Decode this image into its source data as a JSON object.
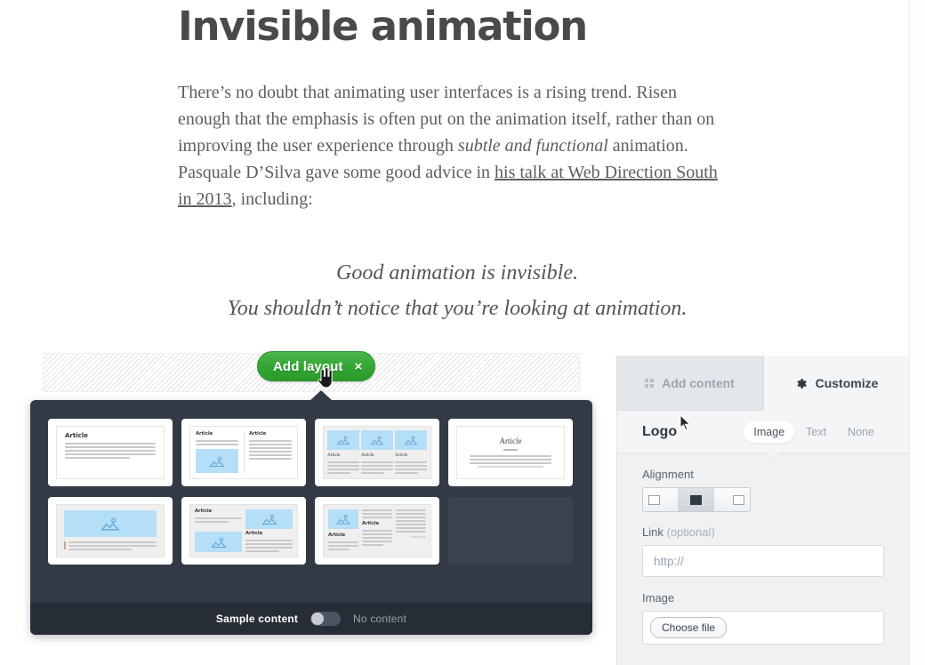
{
  "article": {
    "title": "Invisible animation",
    "paragraph_parts": {
      "p1": "There’s no doubt that animating user interfaces is a rising trend. Risen enough that the emphasis is often put on the animation itself, rather than on improving the user experience through ",
      "emphasis": "subtle and functional",
      "p2": " animation. Pasquale D’Silva gave some good advice in ",
      "link": "his talk at Web Direction South in 2013",
      "p3": ", including:"
    },
    "pullquote_line1": "Good animation is invisible.",
    "pullquote_line2": "You shouldn’t notice that you’re looking at animation."
  },
  "editor": {
    "add_layout_label": "Add layout",
    "close_label": "×",
    "accent_green": "#32a532",
    "panel_dark": "#323a45",
    "footer_dark": "#272d36",
    "toggle": {
      "on_label": "Sample content",
      "off_label": "No content",
      "state": "on"
    },
    "layouts": [
      {
        "id": "single-article",
        "title": "Article"
      },
      {
        "id": "two-column-image-left",
        "title_left": "Article",
        "title_right": "Article"
      },
      {
        "id": "three-column-cards",
        "title_a": "Article",
        "title_b": "Article",
        "title_c": "Article"
      },
      {
        "id": "centered-article",
        "title": "Article"
      },
      {
        "id": "hero-image",
        "title": ""
      },
      {
        "id": "mixed-grid",
        "title_a": "Article",
        "title_b": "Article"
      },
      {
        "id": "image-with-columns",
        "title_a": "Article",
        "title_b": "Article"
      },
      {
        "id": "empty-slot",
        "title": ""
      }
    ]
  },
  "sidebar": {
    "tabs": [
      {
        "id": "add-content",
        "label": "Add content",
        "icon": "grid-dots-icon",
        "active": false
      },
      {
        "id": "customize",
        "label": "Customize",
        "icon": "gear-icon",
        "active": true
      }
    ],
    "section": {
      "title": "Logo",
      "segments": [
        {
          "label": "Image",
          "active": true
        },
        {
          "label": "Text",
          "active": false
        },
        {
          "label": "None",
          "active": false
        }
      ]
    },
    "fields": {
      "alignment_label": "Alignment",
      "alignment_options": [
        "left",
        "center",
        "right"
      ],
      "alignment_value": "center",
      "link_label": "Link",
      "link_optional": "(optional)",
      "link_value": "",
      "link_placeholder": "http://",
      "image_label": "Image",
      "choose_file_label": "Choose file"
    }
  }
}
